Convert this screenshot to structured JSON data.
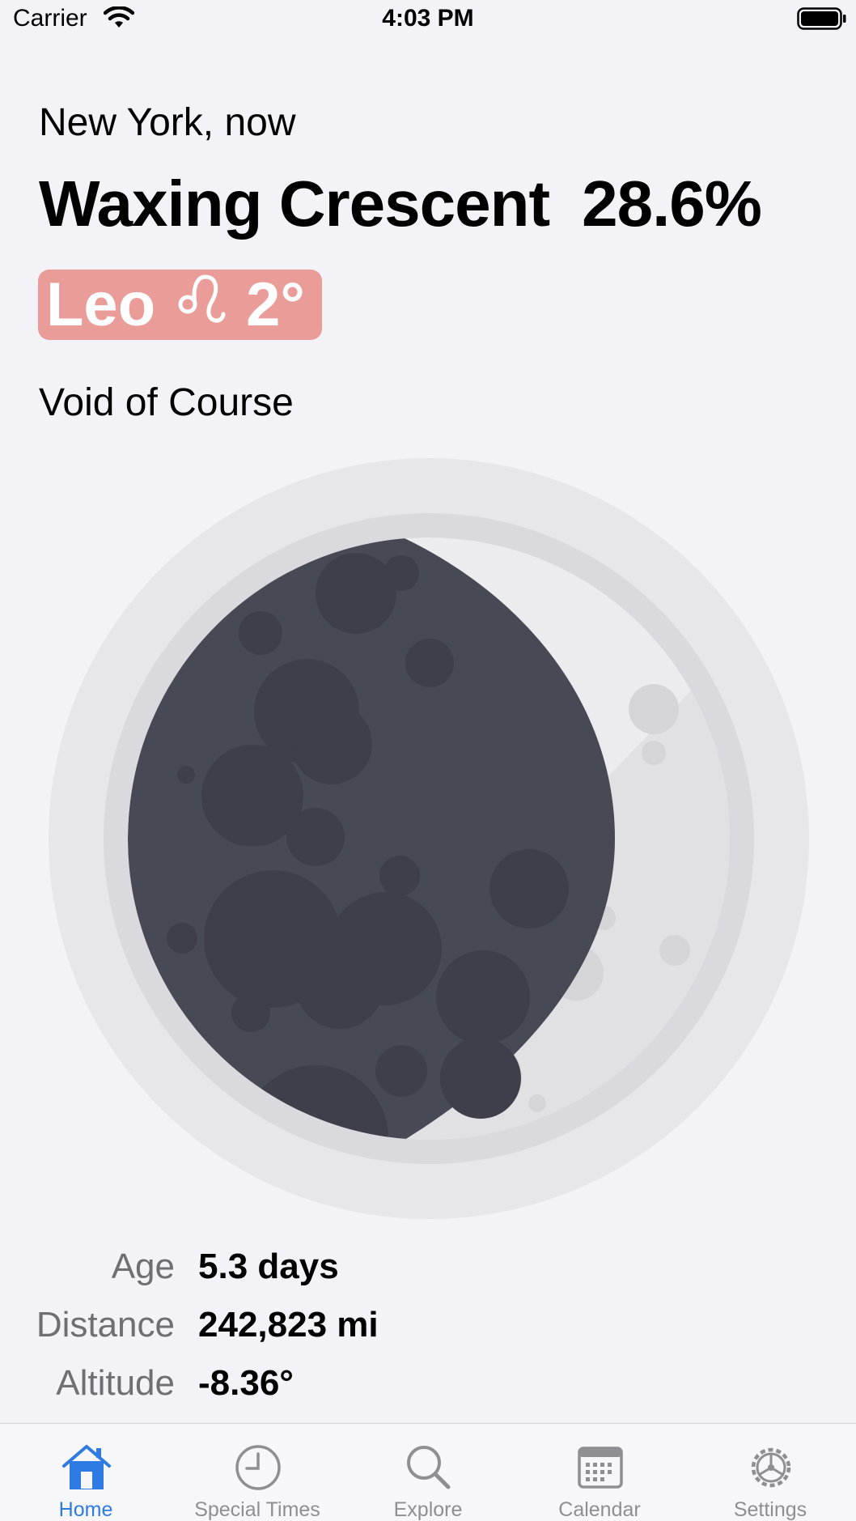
{
  "status_bar": {
    "carrier": "Carrier",
    "time": "4:03 PM"
  },
  "header": {
    "location": "New York, now",
    "phase_name": "Waxing Crescent",
    "illumination": "28.6%"
  },
  "zodiac": {
    "sign": "Leo",
    "symbol": "♌",
    "degree": "2°",
    "color": "#ea9c98"
  },
  "void_status": "Void of Course",
  "stats": {
    "age": {
      "label": "Age",
      "value": "5.3 days"
    },
    "distance": {
      "label": "Distance",
      "value": "242,823 mi"
    },
    "altitude": {
      "label": "Altitude",
      "value": "-8.36°"
    }
  },
  "tabs": [
    {
      "label": "Home",
      "icon": "house-icon",
      "active": true
    },
    {
      "label": "Special Times",
      "icon": "clock-icon",
      "active": false
    },
    {
      "label": "Explore",
      "icon": "magnifier-icon",
      "active": false
    },
    {
      "label": "Calendar",
      "icon": "calendar-icon",
      "active": false
    },
    {
      "label": "Settings",
      "icon": "gear-icon",
      "active": false
    }
  ],
  "colors": {
    "accent": "#2f7be4",
    "inactive_tab": "#8e8e93",
    "moon_dark": "#474955"
  }
}
